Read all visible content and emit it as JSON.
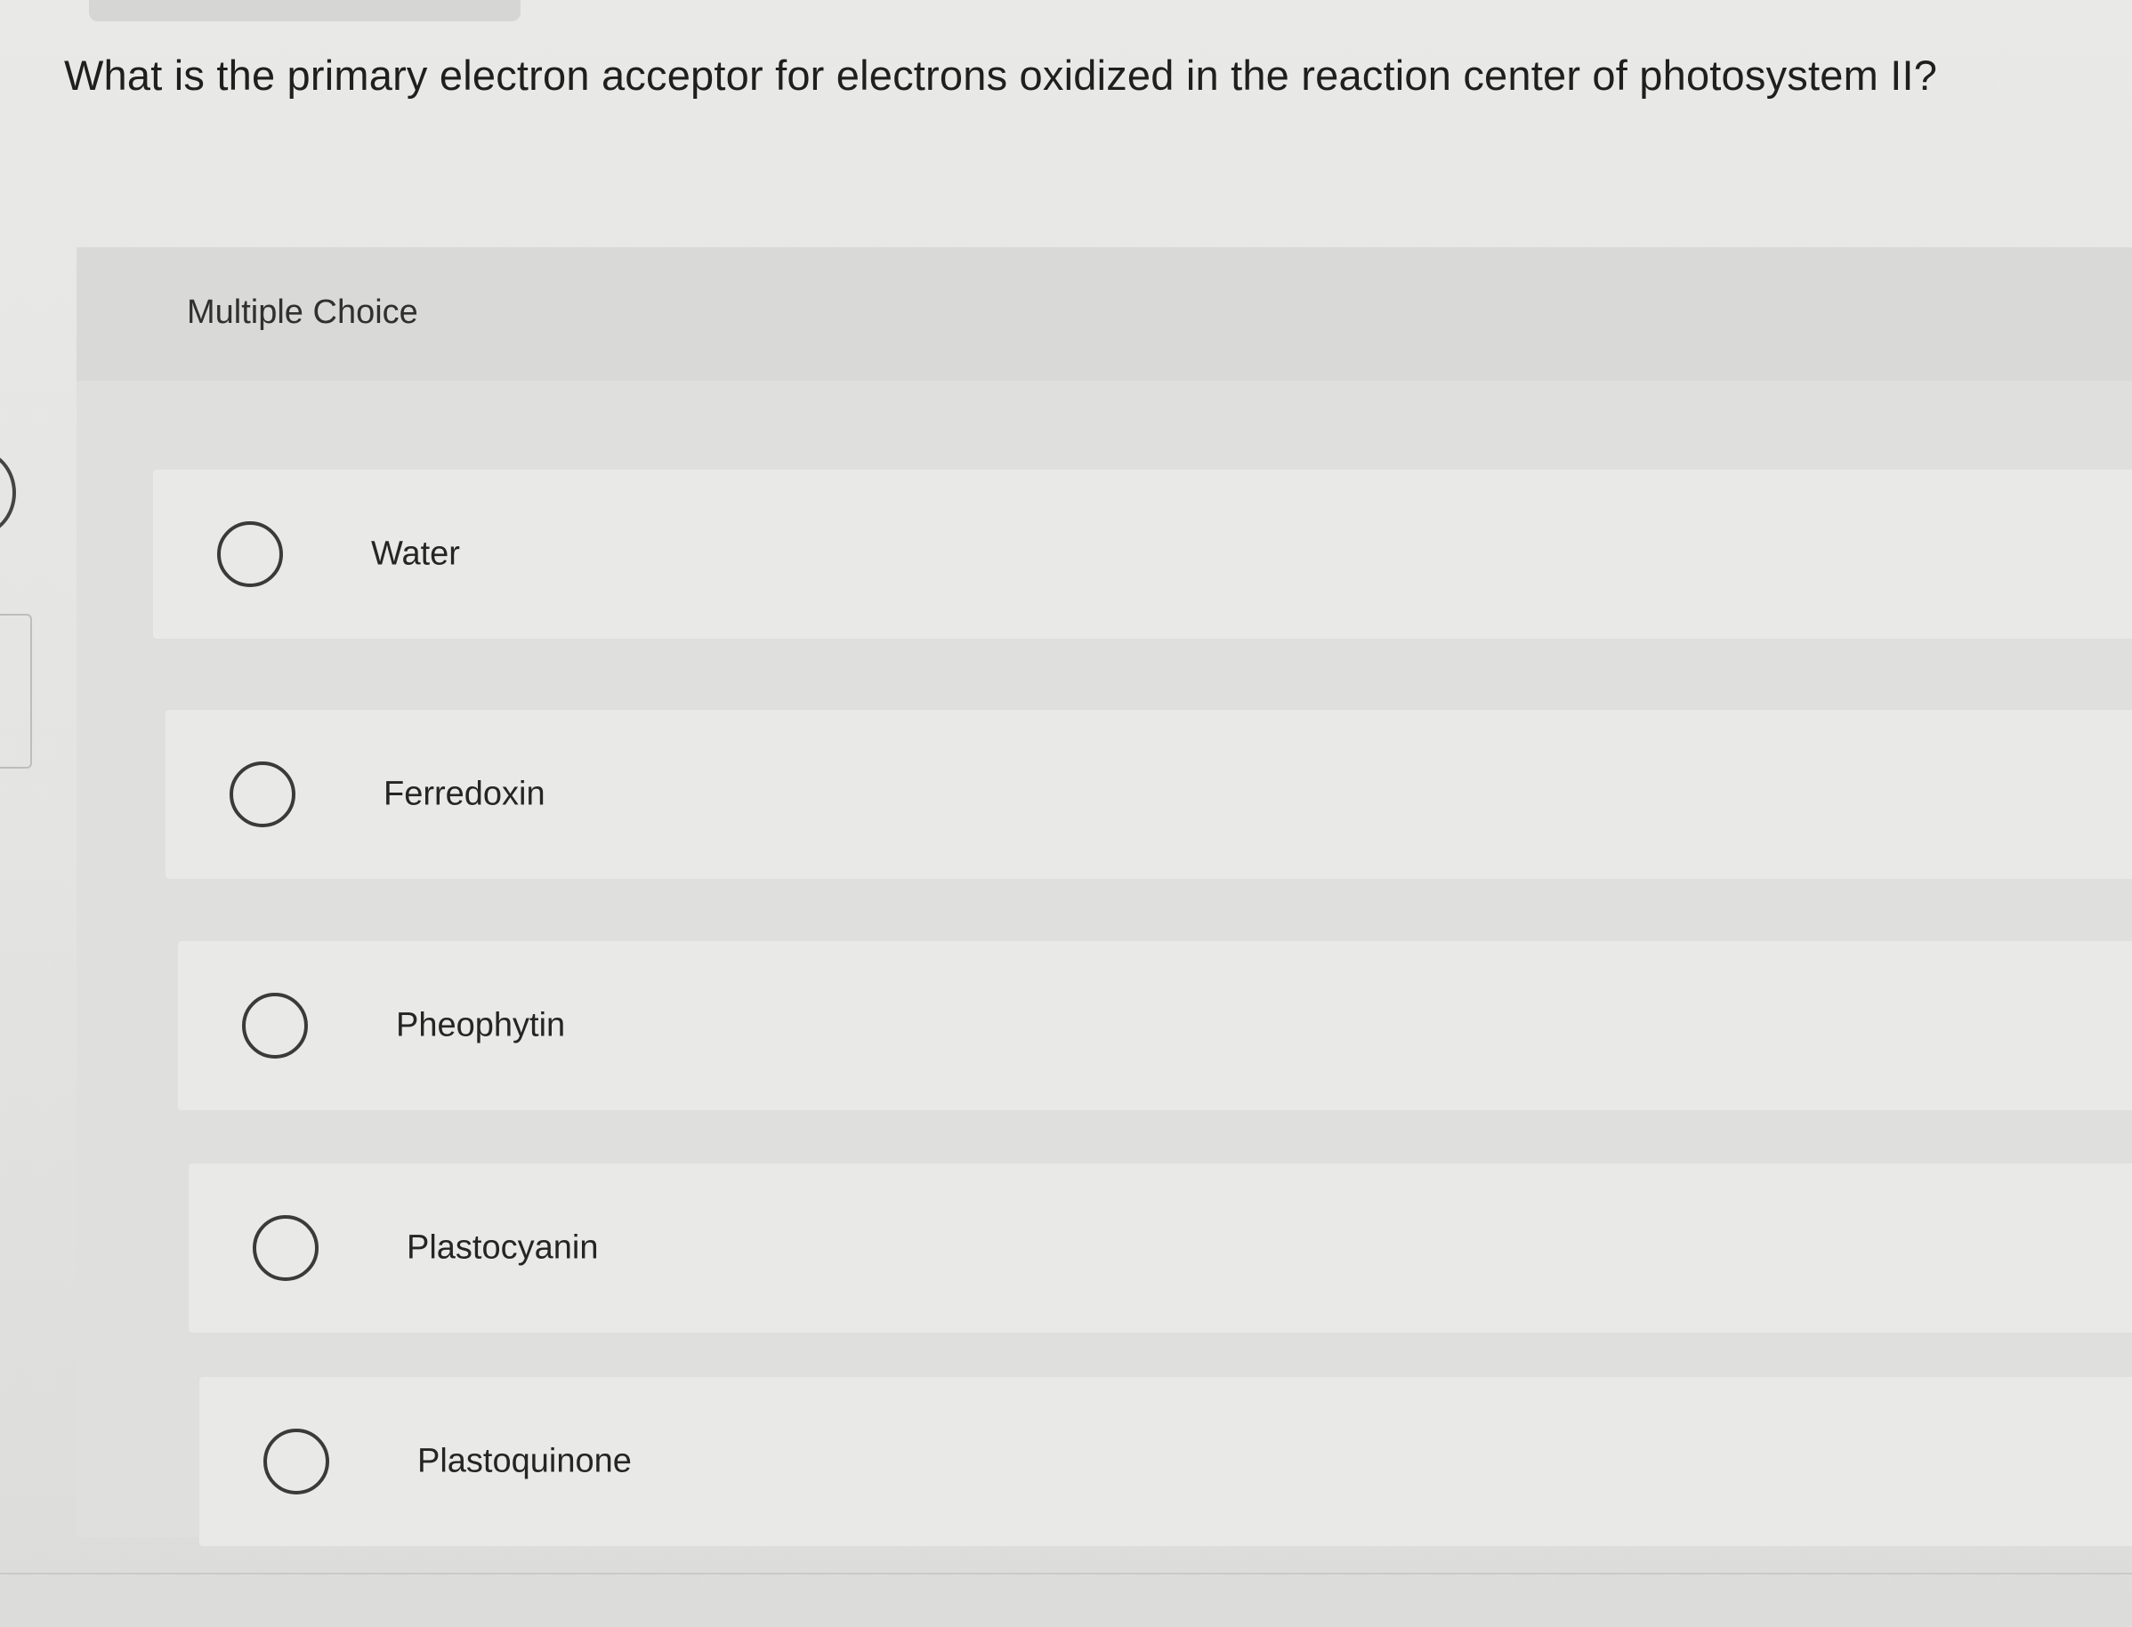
{
  "question": {
    "text": "What is the primary electron acceptor for electrons oxidized in the reaction center of photosystem II?"
  },
  "card": {
    "label": "Multiple Choice"
  },
  "choices": [
    {
      "label": "Water"
    },
    {
      "label": "Ferredoxin"
    },
    {
      "label": "Pheophytin"
    },
    {
      "label": "Plastocyanin"
    },
    {
      "label": "Plastoquinone"
    }
  ]
}
